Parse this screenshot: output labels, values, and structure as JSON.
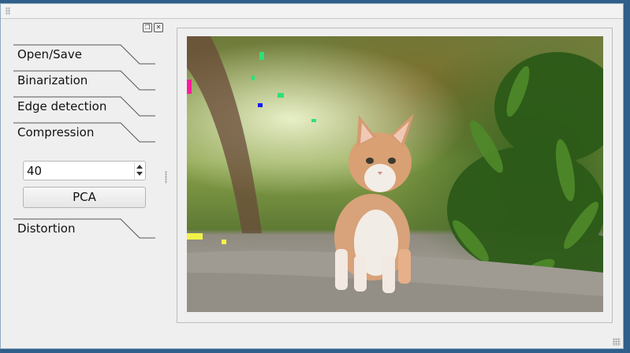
{
  "sidebar": {
    "sections": [
      {
        "label": "Open/Save"
      },
      {
        "label": "Binarization"
      },
      {
        "label": "Edge detection"
      },
      {
        "label": "Compression"
      },
      {
        "label": "Distortion"
      }
    ],
    "compression": {
      "components_value": "40",
      "pca_button_label": "PCA"
    },
    "dock_icons": [
      "float-icon",
      "close-icon"
    ]
  },
  "image": {
    "subject": "kitten-photo"
  }
}
